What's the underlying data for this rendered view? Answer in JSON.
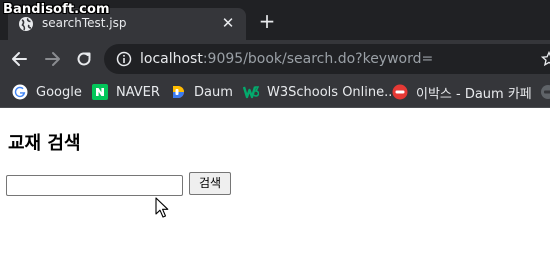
{
  "watermark": "Bandisoft.com",
  "browser": {
    "tab": {
      "title": "searchTest.jsp",
      "favicon": "globe-icon"
    },
    "address": {
      "host": "localhost",
      "rest": ":9095/book/search.do?keyword="
    },
    "bookmarks": [
      {
        "label": "Google",
        "icon": "google-icon",
        "color": "#4285f4"
      },
      {
        "label": "NAVER",
        "icon": "naver-icon",
        "color": "#03c75a"
      },
      {
        "label": "Daum",
        "icon": "daum-icon",
        "color": "#ff5a4a"
      },
      {
        "label": "W3Schools Online...",
        "icon": "w3schools-icon",
        "color": "#04aa6d"
      },
      {
        "label": "이박스 - Daum 카페",
        "icon": "daum-cafe-icon",
        "color": "#e53935"
      }
    ]
  },
  "page": {
    "heading": "교재 검색",
    "search": {
      "value": "",
      "button_label": "검색"
    }
  },
  "colors": {
    "tabstrip": "#202124",
    "toolbar": "#35363a",
    "omnibox": "#202124"
  }
}
